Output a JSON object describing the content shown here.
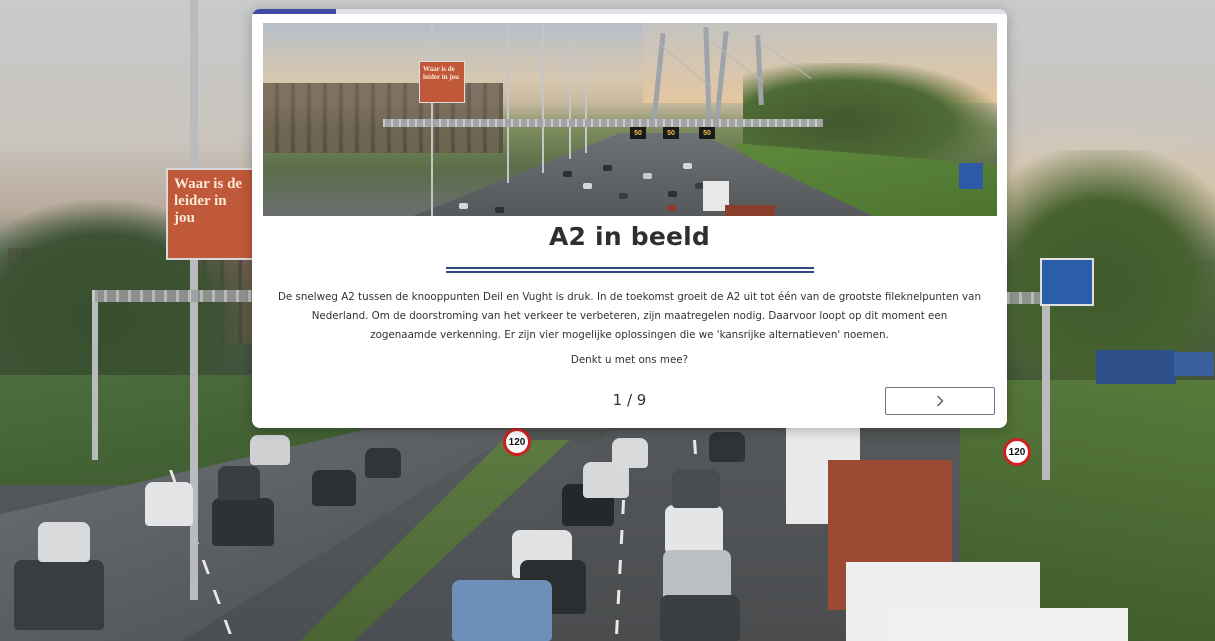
{
  "background": {
    "billboard_text": "Waar is de leider in jou",
    "speed_limit_1": "120",
    "speed_limit_2": "120"
  },
  "slide": {
    "progress_fraction": 0.111,
    "hero_image": {
      "vms_signs": [
        "50",
        "50",
        "50"
      ],
      "billboard_text": "Waar is de leider in jou"
    },
    "title": "A2 in beeld",
    "intro": "De snelweg A2 tussen de knooppunten Deil en Vught is druk. In de toekomst groeit de A2 uit tot één van de grootste fileknelpunten van Nederland. Om de doorstroming van het verkeer te verbeteren, zijn maatregelen nodig. Daarvoor loopt op dit moment een zogenaamde verkenning. Er zijn vier mogelijke oplossingen die we 'kansrijke alternatieven' noemen.",
    "question": "Denkt u met ons mee?",
    "pager": "1 / 9",
    "next_icon": "chevron-right-icon"
  },
  "colors": {
    "progress": "#3f4aa5",
    "divider": "#2e4a7a",
    "text": "#333333",
    "title": "#2f2f2f"
  }
}
